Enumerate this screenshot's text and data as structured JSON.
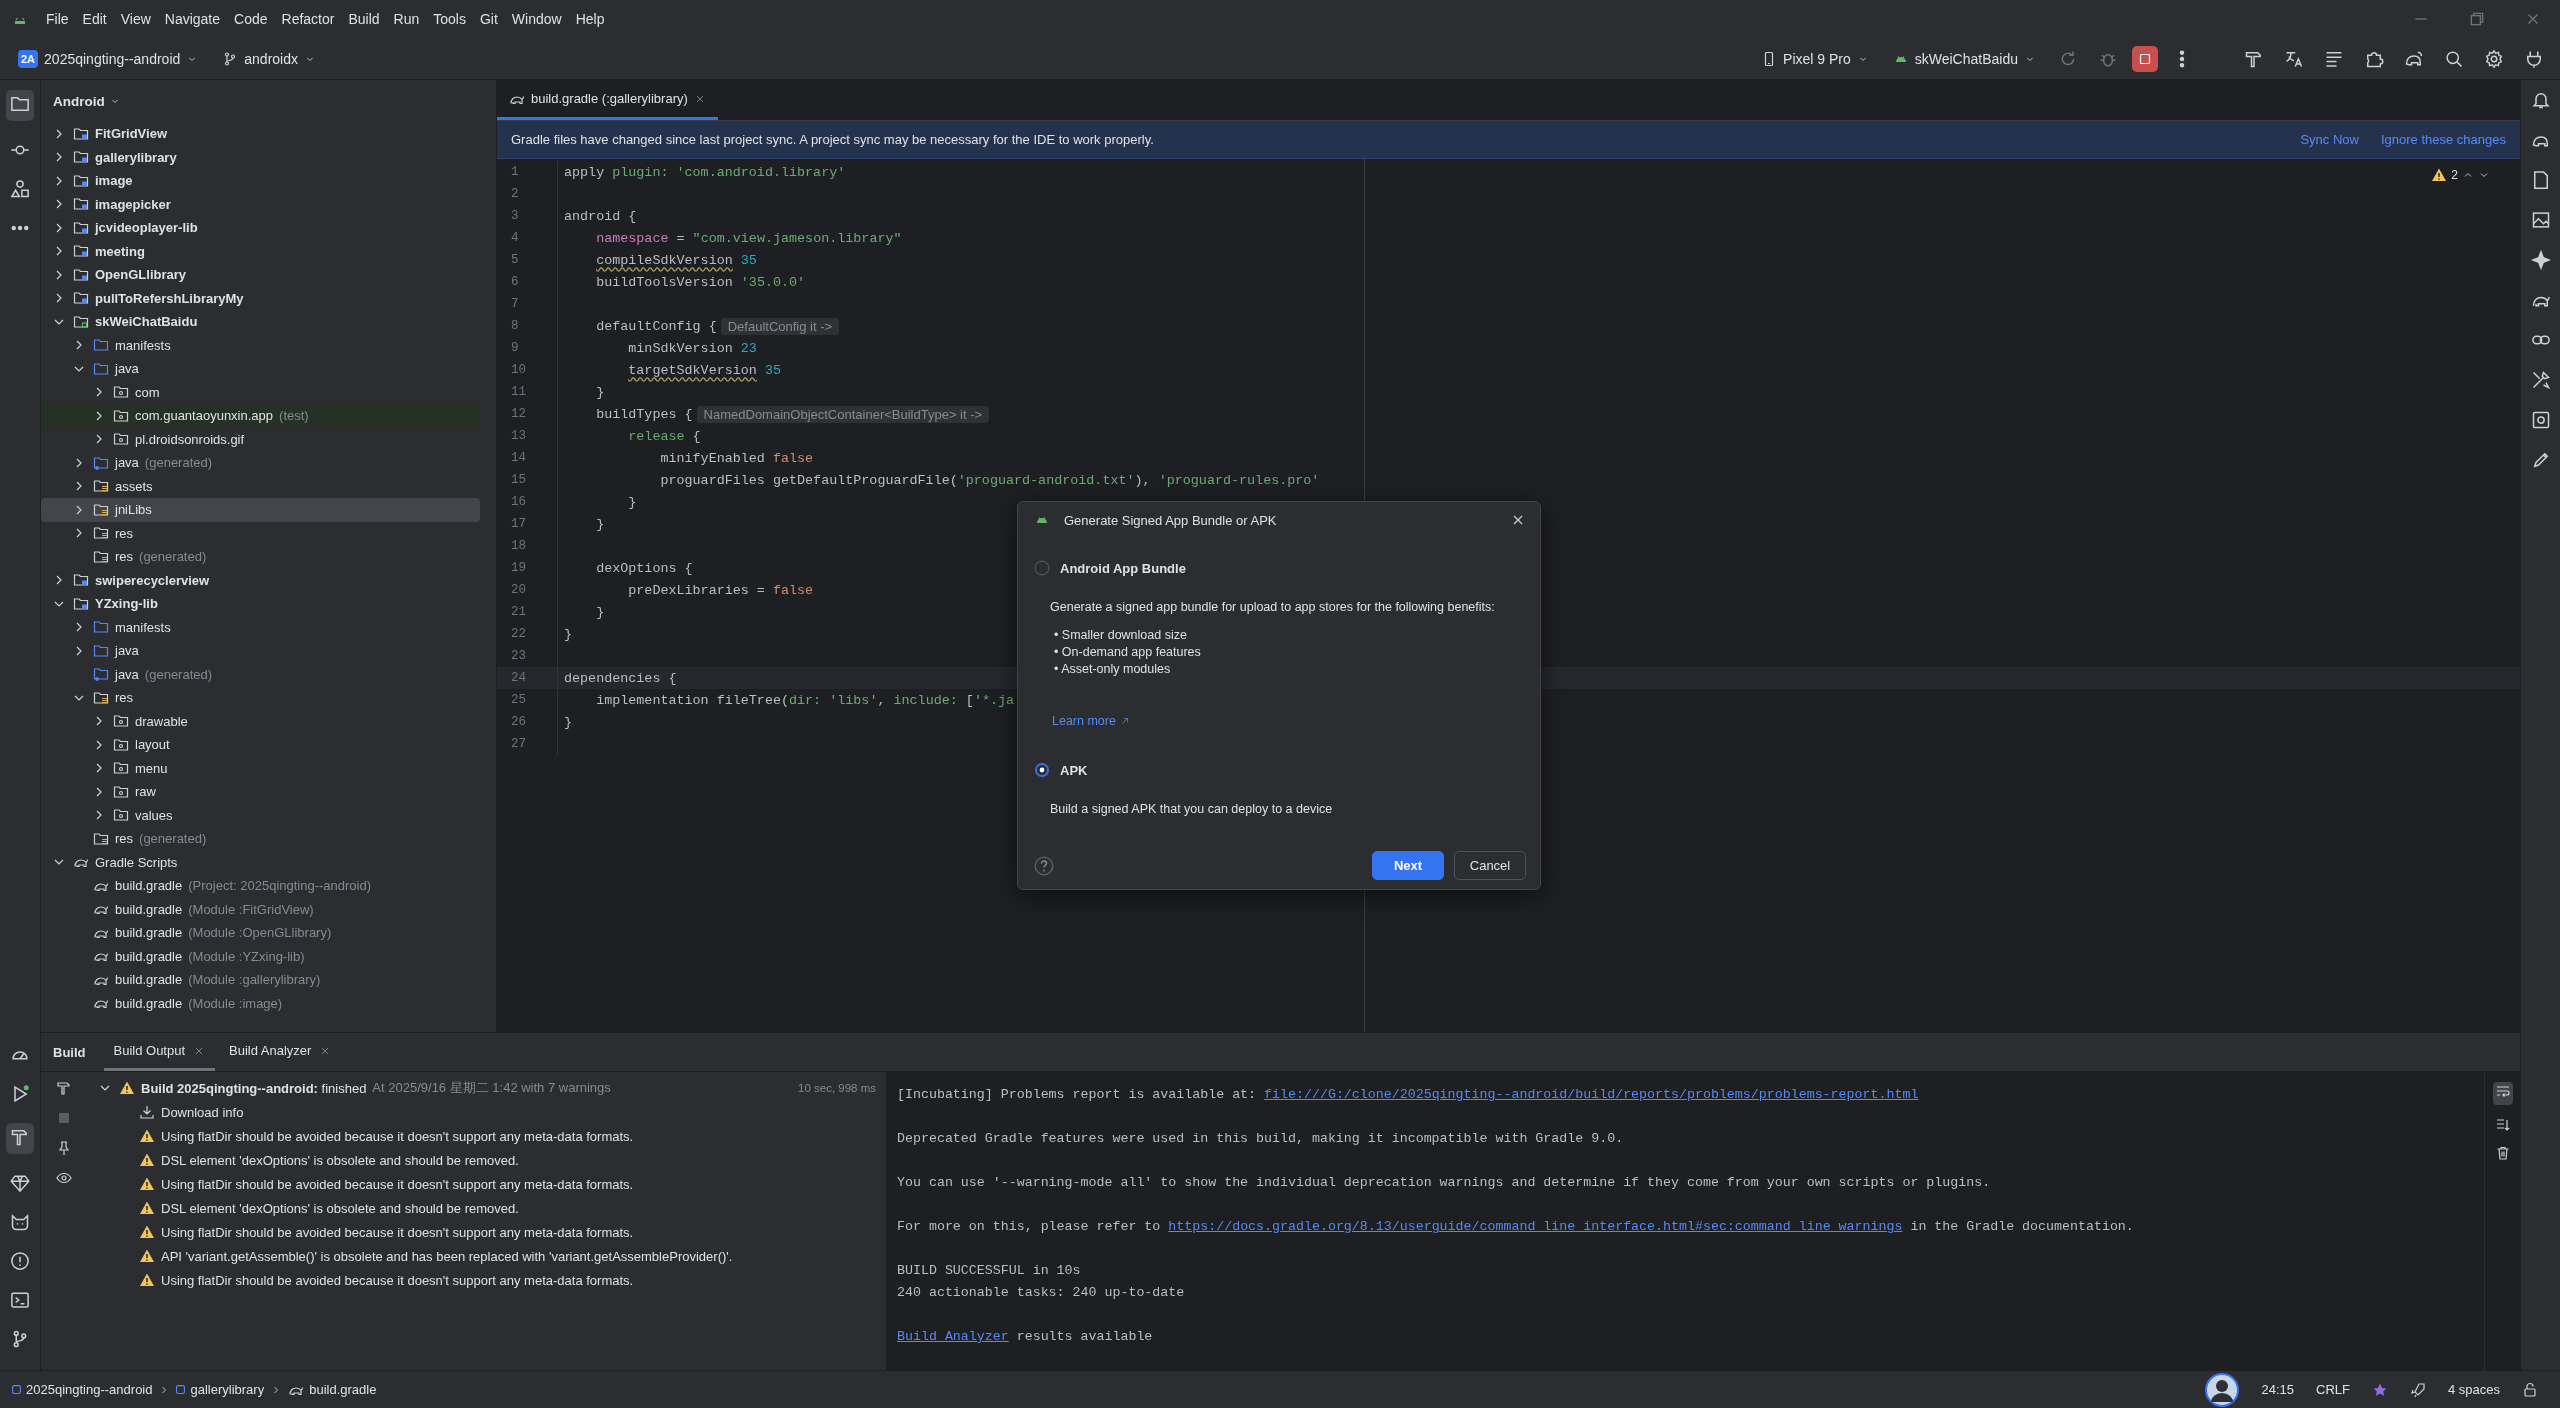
{
  "menu_bar": {
    "items": [
      "File",
      "Edit",
      "View",
      "Navigate",
      "Code",
      "Refactor",
      "Build",
      "Run",
      "Tools",
      "Git",
      "Window",
      "Help"
    ]
  },
  "toolbar": {
    "project_badge": "2A",
    "project": "2025qingting--android",
    "branch": "androidx",
    "device": "Pixel 9 Pro",
    "run_config": "skWeiChatBaidu"
  },
  "project_panel": {
    "view": "Android",
    "tree": [
      {
        "label": "FitGridView",
        "kind": "module",
        "expanded": false,
        "selected": false
      },
      {
        "label": "gallerylibrary",
        "kind": "module",
        "expanded": false,
        "selected": false
      },
      {
        "label": "image",
        "kind": "module",
        "expanded": false,
        "selected": false
      },
      {
        "label": "imagepicker",
        "kind": "module",
        "expanded": false,
        "selected": false
      },
      {
        "label": "jcvideoplayer-lib",
        "kind": "module",
        "expanded": false,
        "selected": false
      },
      {
        "label": "meeting",
        "kind": "module",
        "expanded": false,
        "selected": false
      },
      {
        "label": "OpenGLlibrary",
        "kind": "module",
        "expanded": false,
        "selected": false
      },
      {
        "label": "pullToRefershLibraryMy",
        "kind": "module",
        "expanded": false,
        "selected": false
      },
      {
        "label": "skWeiChatBaidu",
        "kind": "app-module",
        "expanded": true,
        "selected": false,
        "children": [
          {
            "label": "manifests",
            "kind": "source-folder",
            "expanded": false,
            "selected": false
          },
          {
            "label": "java",
            "kind": "source-folder",
            "expanded": true,
            "selected": false,
            "children": [
              {
                "label": "com",
                "kind": "package",
                "expanded": false,
                "selected": false
              },
              {
                "label": "com.guantaoyunxin.app",
                "note": "(test)",
                "kind": "test-package",
                "expanded": false,
                "selected": false
              },
              {
                "label": "pl.droidsonroids.gif",
                "kind": "package",
                "expanded": false,
                "selected": false
              }
            ]
          },
          {
            "label": "java",
            "note": "(generated)",
            "kind": "generated-folder",
            "expanded": false,
            "selected": false
          },
          {
            "label": "assets",
            "kind": "resource-folder",
            "expanded": false,
            "selected": false
          },
          {
            "label": "jniLibs",
            "kind": "resource-folder",
            "expanded": false,
            "selected": true
          },
          {
            "label": "res",
            "kind": "resource-folder",
            "expanded": false,
            "selected": false
          },
          {
            "label": "res",
            "note": "(generated)",
            "kind": "resource-folder",
            "selected": false
          }
        ]
      },
      {
        "label": "swiperecyclerview",
        "kind": "module",
        "expanded": false,
        "selected": false
      },
      {
        "label": "YZxing-lib",
        "kind": "module",
        "expanded": true,
        "selected": false,
        "children": [
          {
            "label": "manifests",
            "kind": "source-folder",
            "expanded": false,
            "selected": false
          },
          {
            "label": "java",
            "kind": "source-folder",
            "expanded": false,
            "selected": false
          },
          {
            "label": "java",
            "note": "(generated)",
            "kind": "generated-folder",
            "selected": false
          },
          {
            "label": "res",
            "kind": "resource-folder",
            "expanded": true,
            "selected": false,
            "children": [
              {
                "label": "drawable",
                "kind": "package",
                "expanded": false,
                "selected": false
              },
              {
                "label": "layout",
                "kind": "package",
                "expanded": false,
                "selected": false
              },
              {
                "label": "menu",
                "kind": "package",
                "expanded": false,
                "selected": false
              },
              {
                "label": "raw",
                "kind": "package",
                "expanded": false,
                "selected": false
              },
              {
                "label": "values",
                "kind": "package",
                "expanded": false,
                "selected": false
              }
            ]
          },
          {
            "label": "res",
            "note": "(generated)",
            "kind": "resource-folder",
            "selected": false
          }
        ]
      },
      {
        "label": "Gradle Scripts",
        "kind": "gradle-group",
        "expanded": true,
        "selected": false,
        "children": [
          {
            "label": "build.gradle",
            "note": "(Project: 2025qingting--android)",
            "kind": "gradle-file",
            "selected": false
          },
          {
            "label": "build.gradle",
            "note": "(Module :FitGridView)",
            "kind": "gradle-file",
            "selected": false
          },
          {
            "label": "build.gradle",
            "note": "(Module :OpenGLlibrary)",
            "kind": "gradle-file",
            "selected": false
          },
          {
            "label": "build.gradle",
            "note": "(Module :YZxing-lib)",
            "kind": "gradle-file",
            "selected": false
          },
          {
            "label": "build.gradle",
            "note": "(Module :gallerylibrary)",
            "kind": "gradle-file",
            "selected": false
          },
          {
            "label": "build.gradle",
            "note": "(Module :image)",
            "kind": "gradle-file",
            "selected": false
          }
        ]
      }
    ]
  },
  "editor": {
    "tabs": [
      {
        "label": "build.gradle (:gallerylibrary)",
        "selected": true
      }
    ],
    "banner": {
      "message": "Gradle files have changed since last project sync. A project sync may be necessary for the IDE to work properly.",
      "actions": [
        "Sync Now",
        "Ignore these changes"
      ]
    },
    "problems": "2",
    "lines": [
      {
        "number": "1",
        "current": false,
        "segments": [
          {
            "kind": "plain",
            "text": "apply "
          },
          {
            "kind": "param",
            "text": "plugin:"
          },
          {
            "kind": "string",
            "text": " 'com.android.library'"
          }
        ]
      },
      {
        "number": "2",
        "current": false
      },
      {
        "number": "3",
        "current": false,
        "segments": [
          {
            "kind": "plain",
            "text": "android {"
          }
        ]
      },
      {
        "number": "4",
        "current": false,
        "segments": [
          {
            "kind": "field",
            "text": "    namespace"
          },
          {
            "kind": "plain",
            "text": " = "
          },
          {
            "kind": "string",
            "text": "\"com.view.jameson.library\""
          }
        ]
      },
      {
        "number": "5",
        "current": false,
        "segments": [
          {
            "kind": "warned",
            "text": "    compileSdkVersion"
          },
          {
            "kind": "number",
            "text": " 35"
          }
        ]
      },
      {
        "number": "6",
        "current": false,
        "segments": [
          {
            "kind": "plain",
            "text": "    buildToolsVersion "
          },
          {
            "kind": "string",
            "text": "'35.0.0'"
          }
        ]
      },
      {
        "number": "7",
        "current": false
      },
      {
        "number": "8",
        "current": false,
        "segments": [
          {
            "kind": "plain",
            "text": "    defaultConfig {"
          }
        ],
        "hint": "DefaultConfig it ->"
      },
      {
        "number": "9",
        "current": false,
        "segments": [
          {
            "kind": "plain",
            "text": "        minSdkVersion "
          },
          {
            "kind": "number",
            "text": "23"
          }
        ]
      },
      {
        "number": "10",
        "current": false,
        "segments": [
          {
            "kind": "warned",
            "text": "        targetSdkVersion"
          },
          {
            "kind": "number",
            "text": " 35"
          }
        ]
      },
      {
        "number": "11",
        "current": false,
        "segments": [
          {
            "kind": "plain",
            "text": "    }"
          }
        ]
      },
      {
        "number": "12",
        "current": false,
        "segments": [
          {
            "kind": "plain",
            "text": "    buildTypes {"
          }
        ],
        "hint": "NamedDomainObjectContainer<BuildType> it ->"
      },
      {
        "number": "13",
        "current": false,
        "segments": [
          {
            "kind": "param",
            "text": "        release"
          },
          {
            "kind": "plain",
            "text": " {"
          }
        ]
      },
      {
        "number": "14",
        "current": false,
        "segments": [
          {
            "kind": "plain",
            "text": "            minifyEnabled "
          },
          {
            "kind": "keyword",
            "text": "false"
          }
        ]
      },
      {
        "number": "15",
        "current": false,
        "segments": [
          {
            "kind": "plain",
            "text": "            proguardFiles getDefaultProguardFile("
          },
          {
            "kind": "string",
            "text": "'proguard-android.txt'"
          },
          {
            "kind": "plain",
            "text": "), "
          },
          {
            "kind": "string",
            "text": "'proguard-rules.pro'"
          }
        ]
      },
      {
        "number": "16",
        "current": false,
        "segments": [
          {
            "kind": "plain",
            "text": "        }"
          }
        ]
      },
      {
        "number": "17",
        "current": false,
        "segments": [
          {
            "kind": "plain",
            "text": "    }"
          }
        ]
      },
      {
        "number": "18",
        "current": false
      },
      {
        "number": "19",
        "current": false,
        "segments": [
          {
            "kind": "plain",
            "text": "    dexOptions {"
          }
        ]
      },
      {
        "number": "20",
        "current": false,
        "segments": [
          {
            "kind": "plain",
            "text": "        preDexLibraries = "
          },
          {
            "kind": "keyword",
            "text": "false"
          }
        ]
      },
      {
        "number": "21",
        "current": false,
        "segments": [
          {
            "kind": "plain",
            "text": "    }"
          }
        ]
      },
      {
        "number": "22",
        "current": false,
        "segments": [
          {
            "kind": "plain",
            "text": "}"
          }
        ]
      },
      {
        "number": "23",
        "current": false
      },
      {
        "number": "24",
        "current": true,
        "segments": [
          {
            "kind": "plain",
            "text": "dependencies {"
          }
        ]
      },
      {
        "number": "25",
        "current": false,
        "segments": [
          {
            "kind": "plain",
            "text": "    implementation fileTree("
          },
          {
            "kind": "param",
            "text": "dir:"
          },
          {
            "kind": "string",
            "text": " 'libs'"
          },
          {
            "kind": "plain",
            "text": ", "
          },
          {
            "kind": "param",
            "text": "include:"
          },
          {
            "kind": "plain",
            "text": " ["
          },
          {
            "kind": "string",
            "text": "'*.ja"
          }
        ]
      },
      {
        "number": "26",
        "current": false,
        "segments": [
          {
            "kind": "plain",
            "text": "}"
          }
        ]
      },
      {
        "number": "27",
        "current": false
      }
    ]
  },
  "dialog": {
    "title": "Generate Signed App Bundle or APK",
    "options": [
      {
        "label": "Android App Bundle",
        "selected": false,
        "description": "Generate a signed app bundle for upload to app stores for the following benefits:",
        "bullets": [
          "• Smaller download size",
          "• On-demand app features",
          "• Asset-only modules"
        ],
        "link": "Learn more"
      },
      {
        "label": "APK",
        "selected": true,
        "description": "Build a signed APK that you can deploy to a device"
      }
    ],
    "buttons": [
      {
        "label": "Next",
        "kind": "primary"
      },
      {
        "label": "Cancel",
        "kind": "secondary"
      }
    ]
  },
  "build_panel": {
    "title": "Build",
    "tabs": [
      {
        "label": "Build Output",
        "selected": true
      },
      {
        "label": "Build Analyzer",
        "selected": false
      }
    ],
    "tree": {
      "title": "**Build 2025qingting--android:** finished",
      "detail": "At 2025/9/16 星期二 1:42 with 7 warnings",
      "duration": "10 sec, 998 ms",
      "expanded": true,
      "children": [
        {
          "kind": "download",
          "text": "Download info"
        },
        {
          "kind": "warning",
          "text": "Using flatDir should be avoided because it doesn't support any meta-data formats."
        },
        {
          "kind": "warning",
          "text": "DSL element 'dexOptions' is obsolete and should be removed."
        },
        {
          "kind": "warning",
          "text": "Using flatDir should be avoided because it doesn't support any meta-data formats."
        },
        {
          "kind": "warning",
          "text": "DSL element 'dexOptions' is obsolete and should be removed."
        },
        {
          "kind": "warning",
          "text": "Using flatDir should be avoided because it doesn't support any meta-data formats."
        },
        {
          "kind": "warning",
          "text": "API 'variant.getAssemble()' is obsolete and has been replaced with 'variant.getAssembleProvider()'."
        },
        {
          "kind": "warning",
          "text": "Using flatDir should be avoided because it doesn't support any meta-data formats."
        }
      ]
    },
    "console": [
      {
        "lines": [
          [
            {
              "kind": "plain",
              "text": "[Incubating] Problems report is available at: "
            },
            {
              "kind": "link",
              "text": "file:///G:/clone/2025qingting--android/build/reports/problems/problems-report.html"
            }
          ]
        ]
      },
      {
        "lines": [
          [
            {
              "kind": "plain",
              "text": "Deprecated Gradle features were used in this build, making it incompatible with Gradle 9.0."
            }
          ]
        ]
      },
      {
        "lines": [
          [
            {
              "kind": "plain",
              "text": "You can use '--warning-mode all' to show the individual deprecation warnings and determine if they come from your own scripts or plugins."
            }
          ]
        ]
      },
      {
        "lines": [
          [
            {
              "kind": "plain",
              "text": "For more on this, please refer to "
            },
            {
              "kind": "link",
              "text": "https://docs.gradle.org/8.13/userguide/command_line_interface.html#sec:command_line_warnings"
            },
            {
              "kind": "plain",
              "text": " in the Gradle documentation."
            }
          ]
        ]
      },
      {
        "lines": [
          [
            {
              "kind": "plain",
              "text": "BUILD SUCCESSFUL in 10s"
            }
          ],
          [
            {
              "kind": "plain",
              "text": "240 actionable tasks: 240 up-to-date"
            }
          ]
        ]
      },
      {
        "lines": [
          [
            {
              "kind": "link",
              "text": "Build Analyzer"
            },
            {
              "kind": "plain",
              "text": " results available"
            }
          ]
        ]
      }
    ]
  },
  "status_bar": {
    "breadcrumbs": [
      {
        "label": "2025qingting--android",
        "kind": "module"
      },
      {
        "label": "gallerylibrary",
        "kind": "module"
      },
      {
        "label": "build.gradle",
        "kind": "gradle"
      }
    ],
    "position": "24:15",
    "line_ending": "CRLF",
    "indent": "4 spaces"
  }
}
